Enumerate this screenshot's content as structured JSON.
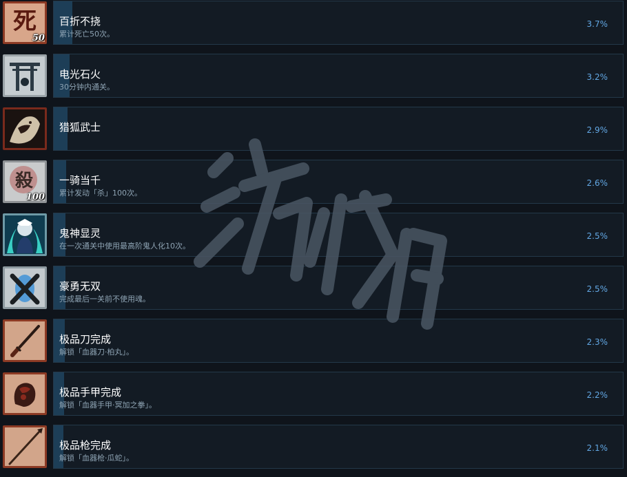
{
  "achievements": [
    {
      "title": "百折不挠",
      "description": "累计死亡50次。",
      "percent": "3.7%",
      "percent_value": 3.7,
      "icon": "skull-kanji-death-icon",
      "badge": "50",
      "glyph": "死"
    },
    {
      "title": "电光石火",
      "description": "30分钟内通关。",
      "percent": "3.2%",
      "percent_value": 3.2,
      "icon": "torii-gate-icon",
      "badge": "",
      "glyph": "⛩"
    },
    {
      "title": "猎狐武士",
      "description": "",
      "percent": "2.9%",
      "percent_value": 2.9,
      "icon": "fox-samurai-icon",
      "badge": "",
      "glyph": ""
    },
    {
      "title": "一骑当千",
      "description": "累计发动「杀」100次。",
      "percent": "2.6%",
      "percent_value": 2.6,
      "icon": "kill-kanji-icon",
      "badge": "100",
      "glyph": "殺"
    },
    {
      "title": "鬼神显灵",
      "description": "在一次通关中使用最高阶鬼人化10次。",
      "percent": "2.5%",
      "percent_value": 2.5,
      "icon": "demon-spirit-icon",
      "badge": "",
      "glyph": ""
    },
    {
      "title": "豪勇无双",
      "description": "完成最后一关前不使用魂。",
      "percent": "2.5%",
      "percent_value": 2.5,
      "icon": "crossed-spirit-icon",
      "badge": "",
      "glyph": ""
    },
    {
      "title": "极品刀完成",
      "description": "解锁「血器刀·柏丸」。",
      "percent": "2.3%",
      "percent_value": 2.3,
      "icon": "blade-sword-icon",
      "badge": "",
      "glyph": ""
    },
    {
      "title": "极品手甲完成",
      "description": "解锁「血器手甲·冥加之拳」。",
      "percent": "2.2%",
      "percent_value": 2.2,
      "icon": "gauntlet-icon",
      "badge": "",
      "glyph": ""
    },
    {
      "title": "极品枪完成",
      "description": "解锁「血器枪·瓜蛇」。",
      "percent": "2.1%",
      "percent_value": 2.1,
      "icon": "spear-icon",
      "badge": "",
      "glyph": ""
    }
  ]
}
